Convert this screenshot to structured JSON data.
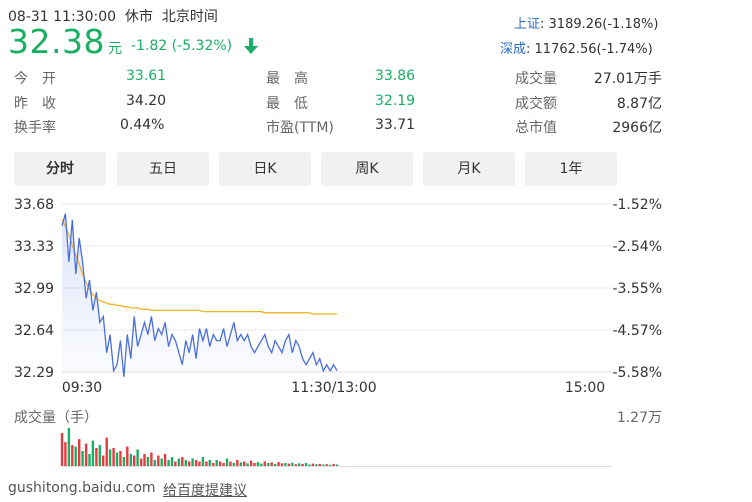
{
  "header": {
    "datetime": "08-31 11:30:00",
    "status": "休市",
    "timezone": "北京时间",
    "price": "32.38",
    "price_unit": "元",
    "change": "-1.82 (-5.32%)",
    "arrow_icon": "arrow-down-icon",
    "down_color": "#1aae62"
  },
  "indices": [
    {
      "label": "上证",
      "value": ": 3189.26(-1.18%)"
    },
    {
      "label": "深成",
      "value": ": 11762.56(-1.74%)"
    }
  ],
  "stats": {
    "open_label": "今　开",
    "open_value": "33.61",
    "prev_close_label": "昨　收",
    "prev_close_value": "34.20",
    "turnover_rate_label": "换手率",
    "turnover_rate_value": "0.44%",
    "high_label": "最　高",
    "high_value": "33.86",
    "low_label": "最　低",
    "low_value": "32.19",
    "pe_label": "市盈(TTM)",
    "pe_value": "33.71",
    "volume_label": "成交量",
    "volume_value": "27.01万手",
    "amount_label": "成交额",
    "amount_value": "8.87亿",
    "market_cap_label": "总市值",
    "market_cap_value": "2966亿"
  },
  "tabs": [
    "分时",
    "五日",
    "日K",
    "周K",
    "月K",
    "1年"
  ],
  "active_tab": "分时",
  "chart_data": {
    "type": "line",
    "y_ticks_left": [
      "33.68",
      "33.33",
      "32.99",
      "32.64",
      "32.29"
    ],
    "y_ticks_right": [
      "-1.52%",
      "-2.54%",
      "-3.55%",
      "-4.57%",
      "-5.58%"
    ],
    "x_ticks": [
      "09:30",
      "11:30/13:00",
      "15:00"
    ],
    "ylim": [
      32.29,
      33.68
    ],
    "prev_close": 34.2,
    "series": [
      {
        "color": "#4a6fdc",
        "values": [
          33.5,
          33.6,
          33.2,
          33.55,
          33.1,
          33.4,
          33.2,
          32.9,
          33.05,
          32.8,
          32.95,
          32.7,
          32.75,
          32.45,
          32.6,
          32.3,
          32.35,
          32.55,
          32.25,
          32.6,
          32.4,
          32.75,
          32.5,
          32.6,
          32.7,
          32.6,
          32.75,
          32.55,
          32.65,
          32.6,
          32.7,
          32.5,
          32.6,
          32.55,
          32.45,
          32.35,
          32.55,
          32.45,
          32.6,
          32.4,
          32.65,
          32.55,
          32.65,
          32.5,
          32.6,
          32.55,
          32.55,
          32.65,
          32.5,
          32.6,
          32.7,
          32.55,
          32.6,
          32.55,
          32.6,
          32.5,
          32.45,
          32.5,
          32.55,
          32.6,
          32.5,
          32.45,
          32.55,
          32.5,
          32.45,
          32.55,
          32.6,
          32.45,
          32.55,
          32.5,
          32.4,
          32.35,
          32.4,
          32.45,
          32.35,
          32.4,
          32.3,
          32.35,
          32.3,
          32.35,
          32.3
        ]
      },
      {
        "color": "#f0b323",
        "values": [
          33.55,
          33.5,
          33.42,
          33.34,
          33.26,
          33.18,
          33.1,
          33.03,
          32.97,
          32.93,
          32.9,
          32.88,
          32.87,
          32.86,
          32.85,
          32.85,
          32.84,
          32.84,
          32.83,
          32.83,
          32.82,
          32.82,
          32.82,
          32.81,
          32.81,
          32.81,
          32.8,
          32.8,
          32.8,
          32.8,
          32.8,
          32.8,
          32.8,
          32.8,
          32.8,
          32.8,
          32.8,
          32.8,
          32.8,
          32.8,
          32.8,
          32.79,
          32.79,
          32.79,
          32.79,
          32.79,
          32.79,
          32.79,
          32.79,
          32.79,
          32.79,
          32.79,
          32.79,
          32.79,
          32.79,
          32.79,
          32.79,
          32.79,
          32.79,
          32.78,
          32.78,
          32.78,
          32.78,
          32.78,
          32.78,
          32.78,
          32.78,
          32.78,
          32.78,
          32.78,
          32.78,
          32.78,
          32.78,
          32.77,
          32.77,
          32.77,
          32.77,
          32.77,
          32.77,
          32.77,
          32.77
        ]
      }
    ],
    "volume": {
      "label": "成交量（手）",
      "max_label": "1.27万",
      "max": 12700,
      "up_color": "#e8393f",
      "down_color": "#1aae62",
      "values": [
        11000,
        8000,
        12700,
        7000,
        6500,
        9000,
        5000,
        7500,
        4000,
        8500,
        6000,
        7000,
        3500,
        9500,
        5500,
        6000,
        4500,
        5000,
        3000,
        6500,
        4000,
        3500,
        5500,
        2500,
        4000,
        3000,
        4500,
        2000,
        3500,
        2500,
        4000,
        2000,
        3000,
        1500,
        2500,
        3000,
        2000,
        1500,
        2500,
        2000,
        1500,
        3000,
        1500,
        2000,
        1000,
        2000,
        1500,
        1000,
        2500,
        1500,
        1000,
        2000,
        1200,
        1500,
        900,
        1800,
        1000,
        1300,
        800,
        1500,
        1000,
        1200,
        700,
        1300,
        900,
        1000,
        800,
        1100,
        600,
        900,
        700,
        1000,
        500,
        800,
        600,
        700,
        500,
        600,
        400,
        700,
        500
      ],
      "up_flags": [
        1,
        1,
        0,
        1,
        0,
        1,
        0,
        1,
        0,
        0,
        1,
        0,
        1,
        1,
        0,
        1,
        0,
        1,
        0,
        1,
        0,
        1,
        0,
        1,
        1,
        0,
        1,
        0,
        1,
        0,
        1,
        0,
        0,
        1,
        0,
        1,
        0,
        1,
        0,
        1,
        1,
        0,
        1,
        0,
        1,
        0,
        1,
        1,
        0,
        1,
        0,
        1,
        0,
        1,
        0,
        1,
        1,
        0,
        0,
        1,
        0,
        1,
        0,
        1,
        1,
        0,
        1,
        0,
        1,
        0,
        1,
        0,
        0,
        1,
        0,
        1,
        0,
        1,
        0,
        1,
        0
      ]
    }
  },
  "footer": {
    "source": "gushitong.baidu.com",
    "feedback_link": "给百度提建议"
  }
}
